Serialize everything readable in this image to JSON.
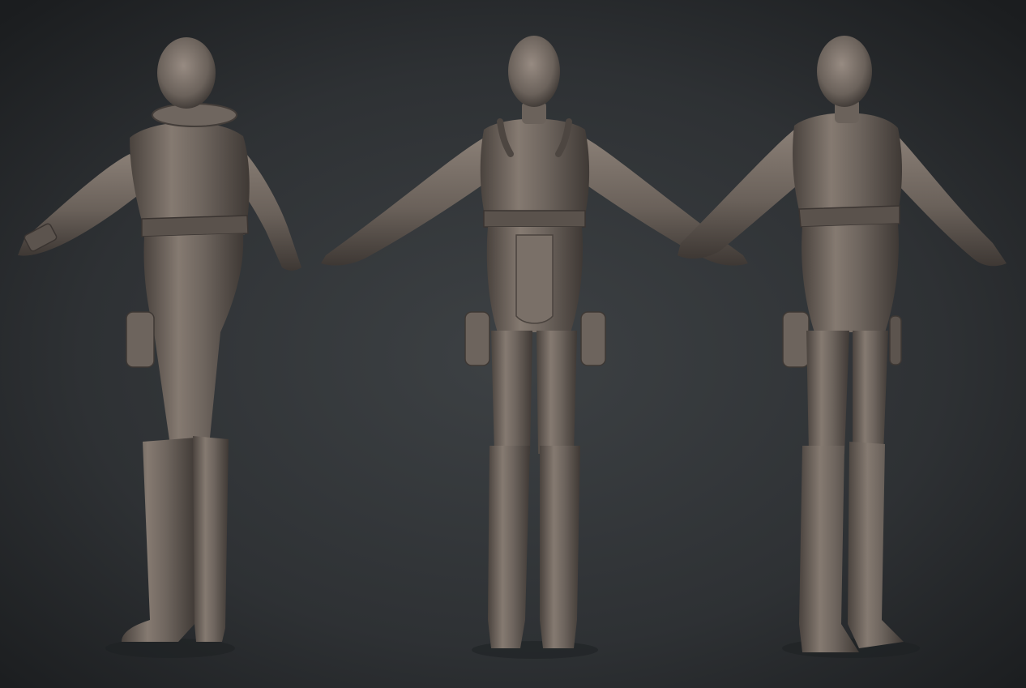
{
  "scene": {
    "subject": "3d-sculpt-turnaround",
    "views": [
      {
        "view": "back-three-quarter"
      },
      {
        "view": "front"
      },
      {
        "view": "front-three-quarter"
      }
    ]
  },
  "colors": {
    "background_top": "#1f2224",
    "background_center": "#3b3f42",
    "background_bottom": "#2a2d30",
    "clay_light": "#8c8178",
    "clay_mid": "#6b625b",
    "clay_dark": "#3e3834",
    "clay_shadow": "#2b2725"
  }
}
